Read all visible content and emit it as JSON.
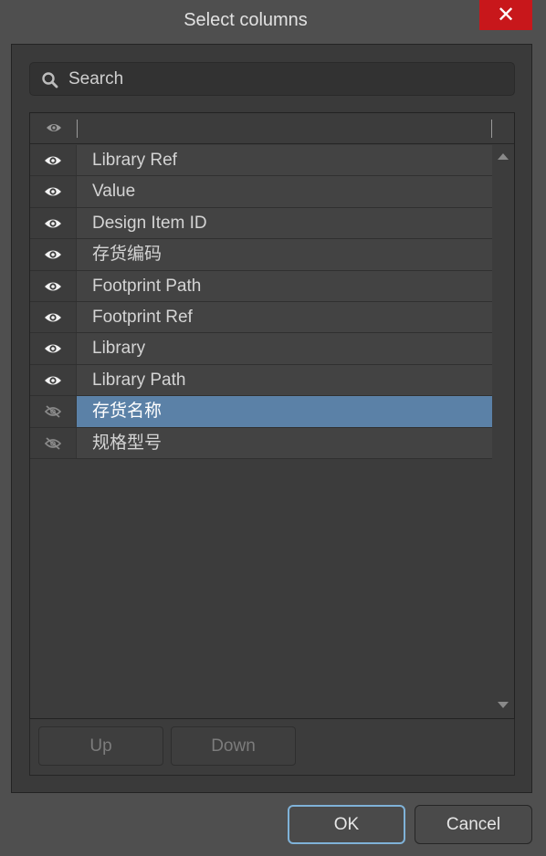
{
  "window": {
    "title": "Select columns",
    "close_label": "✕"
  },
  "search": {
    "placeholder": "Search",
    "value": ""
  },
  "table": {
    "header_visible_icon": "eye-icon",
    "rows": [
      {
        "label": "Library Ref",
        "visible": true,
        "selected": false
      },
      {
        "label": "Value",
        "visible": true,
        "selected": false
      },
      {
        "label": "Design Item ID",
        "visible": true,
        "selected": false
      },
      {
        "label": "存货编码",
        "visible": true,
        "selected": false
      },
      {
        "label": "Footprint Path",
        "visible": true,
        "selected": false
      },
      {
        "label": "Footprint Ref",
        "visible": true,
        "selected": false
      },
      {
        "label": "Library",
        "visible": true,
        "selected": false
      },
      {
        "label": "Library Path",
        "visible": true,
        "selected": false
      },
      {
        "label": "存货名称",
        "visible": false,
        "selected": true
      },
      {
        "label": "规格型号",
        "visible": false,
        "selected": false
      }
    ]
  },
  "reorder": {
    "up_label": "Up",
    "down_label": "Down"
  },
  "dialog_buttons": {
    "ok_label": "OK",
    "cancel_label": "Cancel"
  },
  "colors": {
    "selection": "#5b81a7",
    "close_button": "#c8171b",
    "ok_focus_border": "#7fb2d8"
  }
}
